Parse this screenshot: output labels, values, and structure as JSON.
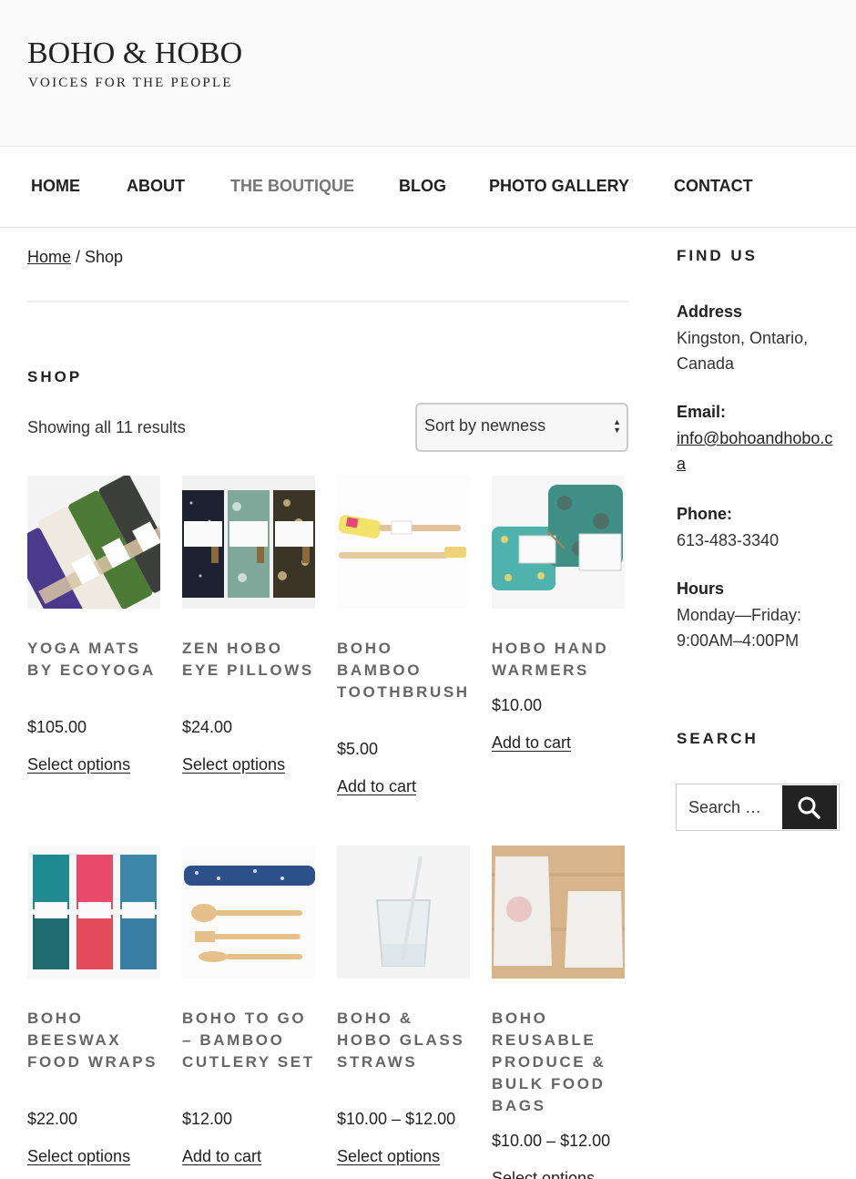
{
  "site": {
    "title": "BOHO & HOBO",
    "tagline": "VOICES FOR THE PEOPLE"
  },
  "nav": {
    "items": [
      {
        "label": "HOME",
        "active": false
      },
      {
        "label": "ABOUT",
        "active": false
      },
      {
        "label": "THE BOUTIQUE",
        "active": true
      },
      {
        "label": "BLOG",
        "active": false
      },
      {
        "label": "PHOTO GALLERY",
        "active": false
      },
      {
        "label": "CONTACT",
        "active": false
      }
    ]
  },
  "breadcrumb": {
    "home": "Home",
    "separator": " / ",
    "current": "Shop"
  },
  "shop": {
    "title": "SHOP",
    "result_count": "Showing all 11 results",
    "sort_value": "Sort by newness",
    "products": [
      {
        "name": "YOGA MATS BY ECOYOGA",
        "price": "$105.00",
        "button": "Select options"
      },
      {
        "name": "ZEN HOBO EYE PILLOWS",
        "price": "$24.00",
        "button": "Select options"
      },
      {
        "name": "BOHO BAMBOO TOOTHBRUSH",
        "price": "$5.00",
        "button": "Add to cart"
      },
      {
        "name": "HOBO HAND WARMERS",
        "price": "$10.00",
        "button": "Add to cart"
      },
      {
        "name": "BOHO BEESWAX FOOD WRAPS",
        "price": "$22.00",
        "button": "Select options"
      },
      {
        "name": "BOHO TO GO – BAMBOO CUTLERY SET",
        "price": "$12.00",
        "button": "Add to cart"
      },
      {
        "name": "BOHO & HOBO GLASS STRAWS",
        "price": "$10.00 – $12.00",
        "button": "Select options"
      },
      {
        "name": "BOHO REUSABLE PRODUCE & BULK FOOD BAGS",
        "price": "$10.00 – $12.00",
        "button": "Select options"
      }
    ]
  },
  "sidebar": {
    "find_us_title": "FIND US",
    "address_label": "Address",
    "address_line1": "Kingston, Ontario,",
    "address_line2": "Canada",
    "email_label": "Email:",
    "email": "info@bohoandhobo.ca",
    "phone_label": "Phone:",
    "phone": "613-483-3340",
    "hours_label": "Hours",
    "hours_days": "Monday—Friday:",
    "hours_time": "9:00AM–4:00PM",
    "search_title": "SEARCH",
    "search_placeholder": "Search …"
  },
  "icons": {
    "search": "search-icon",
    "sort": "sort-arrows-icon"
  }
}
